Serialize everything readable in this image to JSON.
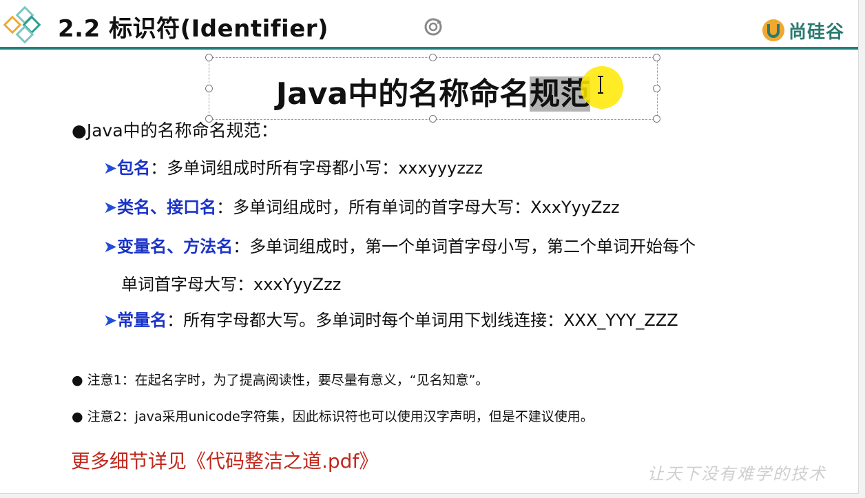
{
  "header": {
    "title": "2.2  标识符(Identifier)",
    "brand": "尚硅谷",
    "accent_color": "#1f7f7f",
    "logo_icon": "diamonds-logo-icon",
    "rotate_icon": "rotate-handle-icon"
  },
  "slide": {
    "heading_main": "Java中的名称命名",
    "heading_selected": "规范",
    "intro": "Java中的名称命名规范：",
    "rules": [
      {
        "key": "包名",
        "text": "：多单词组成时所有字母都小写：xxxyyyzzz"
      },
      {
        "key": "类名、接口名",
        "text": "：多单词组成时，所有单词的首字母大写：XxxYyyZzz"
      },
      {
        "key": "变量名、方法名",
        "text": "：多单词组成时，第一个单词首字母小写，第二个单词开始每个",
        "continuation": "单词首字母大写：xxxYyyZzz"
      },
      {
        "key": "常量名",
        "text": "：所有字母都大写。多单词时每个单词用下划线连接：XXX_YYY_ZZZ"
      }
    ],
    "notes": [
      "注意1：在起名字时，为了提高阅读性，要尽量有意义，“见名知意”。",
      "注意2：java采用unicode字符集，因此标识符也可以使用汉字声明，但是不建议使用。"
    ],
    "more": "更多细节详见《代码整洁之道.pdf》",
    "watermark": "让天下没有难学的技术"
  }
}
